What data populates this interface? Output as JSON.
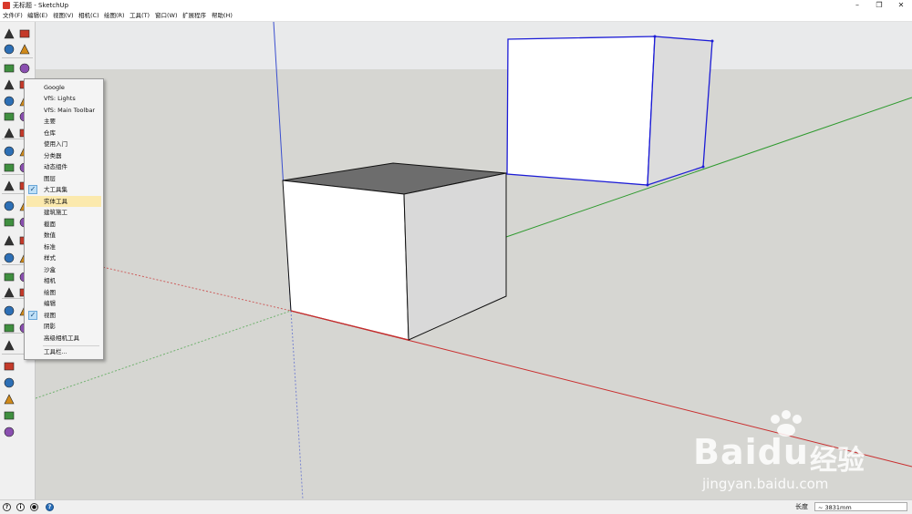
{
  "window": {
    "title": "无标题 - SketchUp",
    "minimize": "–",
    "maximize": "❐",
    "close": "✕"
  },
  "menubar": [
    "文件(F)",
    "编辑(E)",
    "视图(V)",
    "相机(C)",
    "绘图(R)",
    "工具(T)",
    "窗口(W)",
    "扩展程序",
    "帮助(H)"
  ],
  "toolbar_menu": {
    "items": [
      {
        "label": "Google",
        "checked": false,
        "highlighted": false
      },
      {
        "label": "VfS: Lights",
        "checked": false,
        "highlighted": false
      },
      {
        "label": "VfS: Main Toolbar",
        "checked": false,
        "highlighted": false
      },
      {
        "label": "主要",
        "checked": false,
        "highlighted": false
      },
      {
        "label": "仓库",
        "checked": false,
        "highlighted": false
      },
      {
        "label": "使用入门",
        "checked": false,
        "highlighted": false
      },
      {
        "label": "分类器",
        "checked": false,
        "highlighted": false
      },
      {
        "label": "动态组件",
        "checked": false,
        "highlighted": false
      },
      {
        "label": "图层",
        "checked": false,
        "highlighted": false
      },
      {
        "label": "大工具集",
        "checked": true,
        "highlighted": false
      },
      {
        "label": "实体工具",
        "checked": false,
        "highlighted": true
      },
      {
        "label": "建筑施工",
        "checked": false,
        "highlighted": false
      },
      {
        "label": "截面",
        "checked": false,
        "highlighted": false
      },
      {
        "label": "数值",
        "checked": false,
        "highlighted": false
      },
      {
        "label": "标准",
        "checked": false,
        "highlighted": false
      },
      {
        "label": "样式",
        "checked": false,
        "highlighted": false
      },
      {
        "label": "沙盒",
        "checked": false,
        "highlighted": false
      },
      {
        "label": "相机",
        "checked": false,
        "highlighted": false
      },
      {
        "label": "绘图",
        "checked": false,
        "highlighted": false
      },
      {
        "label": "编辑",
        "checked": false,
        "highlighted": false
      },
      {
        "label": "视图",
        "checked": true,
        "highlighted": false
      },
      {
        "label": "阴影",
        "checked": false,
        "highlighted": false
      },
      {
        "label": "高级相机工具",
        "checked": false,
        "highlighted": false
      }
    ],
    "footer": "工具栏..."
  },
  "statusbar": {
    "measure_label": "长度",
    "measure_value": "~ 3831mm"
  },
  "watermark": {
    "brand": "Bai",
    "brand2": "du",
    "cn": "经验",
    "url": "jingyan.baidu.com"
  },
  "colors": {
    "sky": "#e9eaeb",
    "ground": "#d6d6d2",
    "x_axis": "#c92d2d",
    "y_axis": "#2e9a2e",
    "z_axis": "#3b4fcf",
    "selection": "#1c1cd6",
    "menu_highlight": "#fbe9ad"
  },
  "toolbar_icons": [
    "select-icon",
    "eraser-icon",
    "paint-bucket-icon",
    "make-component-icon",
    "line-icon",
    "freehand-icon",
    "rectangle-icon",
    "rotated-rectangle-icon",
    "circle-icon",
    "polygon-icon",
    "arc-icon",
    "pie-icon",
    "2point-arc-icon",
    "3point-arc-icon",
    "move-icon",
    "push-pull-icon",
    "rotate-icon",
    "follow-me-icon",
    "scale-icon",
    "offset-icon",
    "tape-measure-icon",
    "dimension-icon",
    "protractor-icon",
    "text-icon",
    "axes-icon",
    "3d-text-icon",
    "orbit-icon",
    "pan-icon",
    "zoom-icon",
    "zoom-window-icon",
    "zoom-extents-icon",
    "previous-view-icon",
    "position-camera-icon",
    "look-around-icon",
    "walk-icon",
    "section-plane-icon",
    "iso-view-icon",
    "top-view-icon",
    "front-view-icon",
    "right-view-icon",
    "back-view-icon",
    "left-view-icon"
  ]
}
